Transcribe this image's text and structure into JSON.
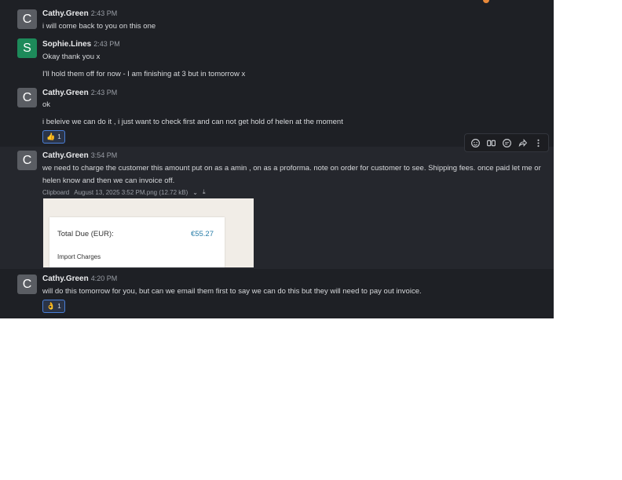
{
  "messages": [
    {
      "author": "Cathy.Green",
      "avatar_letter": "C",
      "time": "2:43 PM",
      "lines": [
        "i will come back to you on this one"
      ]
    },
    {
      "author": "Sophie.Lines",
      "avatar_letter": "S",
      "time": "2:43 PM",
      "lines": [
        "Okay thank you x",
        "I'll hold them off for now - I am finishing at 3 but in tomorrow x"
      ]
    },
    {
      "author": "Cathy.Green",
      "avatar_letter": "C",
      "time": "2:43 PM",
      "lines": [
        "ok",
        "i beleive we can do it , i just want to check first and can not get hold of helen at the moment"
      ],
      "reaction": {
        "emoji": "👍",
        "count": "1"
      }
    },
    {
      "author": "Cathy.Green",
      "avatar_letter": "C",
      "time": "3:54 PM",
      "lines": [
        "we need to charge the customer this amount put on as a amin , on as a proforma. note on order for customer to see. Shipping fees. once paid let me or helen know and then we can invoice off."
      ],
      "attachment": {
        "source": "Clipboard",
        "filename": "August 13, 2025 3:52 PM.png (12.72 kB)",
        "preview": {
          "total_label": "Total Due (EUR):",
          "total_amount": "€55.27",
          "import_label": "Import Charges"
        }
      }
    },
    {
      "author": "Cathy.Green",
      "avatar_letter": "C",
      "time": "4:20 PM",
      "lines": [
        "will do this tomorrow for you, but can we email them first to say we can do this but they will need to pay out invoice."
      ],
      "reaction": {
        "emoji": "👌",
        "count": "1"
      }
    }
  ],
  "toolbar": {
    "icons": [
      "add-reaction-icon",
      "quote-icon",
      "reply-in-thread-icon",
      "forward-icon",
      "more-options-icon"
    ]
  },
  "colors": {
    "background": "#1e2025",
    "accent": "#4a7fd9",
    "avatar_green": "#1d8a5a",
    "avatar_grey": "#5a5d63"
  }
}
